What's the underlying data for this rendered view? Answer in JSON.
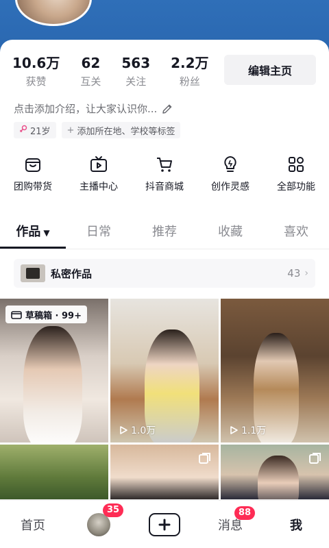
{
  "colors": {
    "banner": "#2f6fb8",
    "accent_badge": "#fe2c55",
    "text_primary": "#161823",
    "text_secondary": "#8a8b91"
  },
  "stats": [
    {
      "value": "10.6万",
      "label": "获赞"
    },
    {
      "value": "62",
      "label": "互关"
    },
    {
      "value": "563",
      "label": "关注"
    },
    {
      "value": "2.2万",
      "label": "粉丝"
    }
  ],
  "edit_profile_label": "编辑主页",
  "bio": "点击添加介绍，让大家认识你...",
  "tags": {
    "age": "21岁",
    "add_tags": "添加所在地、学校等标签"
  },
  "tools": [
    {
      "label": "团购带货",
      "icon": "shopping-bag-icon"
    },
    {
      "label": "主播中心",
      "icon": "tv-play-icon"
    },
    {
      "label": "抖音商城",
      "icon": "cart-icon"
    },
    {
      "label": "创作灵感",
      "icon": "lightbulb-icon"
    },
    {
      "label": "全部功能",
      "icon": "grid-icon"
    }
  ],
  "tabs": [
    {
      "label": "作品",
      "active": true
    },
    {
      "label": "日常",
      "active": false
    },
    {
      "label": "推荐",
      "active": false
    },
    {
      "label": "收藏",
      "active": false
    },
    {
      "label": "喜欢",
      "active": false
    }
  ],
  "private_works": {
    "label": "私密作品",
    "count": "43"
  },
  "grid": {
    "draft_badge": "草稿箱 · 99+",
    "plays": [
      "1.0万",
      "1.1万"
    ]
  },
  "bottom_nav": {
    "home": "首页",
    "friends_badge": "35",
    "messages": "消息",
    "messages_badge": "88",
    "me": "我"
  }
}
